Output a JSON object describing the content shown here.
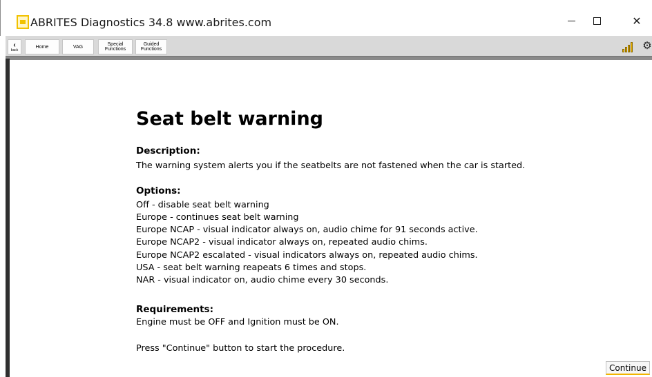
{
  "window": {
    "title": "ABRITES Diagnostics 34.8   www.abrites.com",
    "minimize_icon": "minimize-icon",
    "maximize_icon": "maximize-icon",
    "close_glyph": "✕"
  },
  "toolbar": {
    "back_label": "back",
    "back_glyph": "‹",
    "home_label": "Home",
    "vag_label": "VAG",
    "special_line1": "Special",
    "special_line2": "Functions",
    "guided_line1": "Guided",
    "guided_line2": "Functions",
    "gear_glyph": "⚙",
    "accent_color": "#f2b400"
  },
  "page": {
    "title": "Seat belt warning",
    "description_heading": "Description:",
    "description_text": "The warning system alerts you if the seatbelts are not fastened when the car is started.",
    "options_heading": "Options:",
    "options": [
      "Off - disable seat belt warning",
      "Europe - continues seat belt warning",
      "Europe NCAP - visual indicator always on, audio chime for 91 seconds active.",
      "Europe NCAP2 - visual indicator always on, repeated audio chims.",
      "Europe NCAP2 escalated - visual indicators always on, repeated audio chims.",
      "USA - seat belt warning reapeats 6 times and stops.",
      "NAR - visual indicator on, audio chime every 30 seconds."
    ],
    "requirements_heading": "Requirements:",
    "requirements_text": "Engine must be OFF and Ignition must be ON.",
    "instruction_text": "Press \"Continue\" button to start the procedure.",
    "continue_label": "Continue"
  }
}
